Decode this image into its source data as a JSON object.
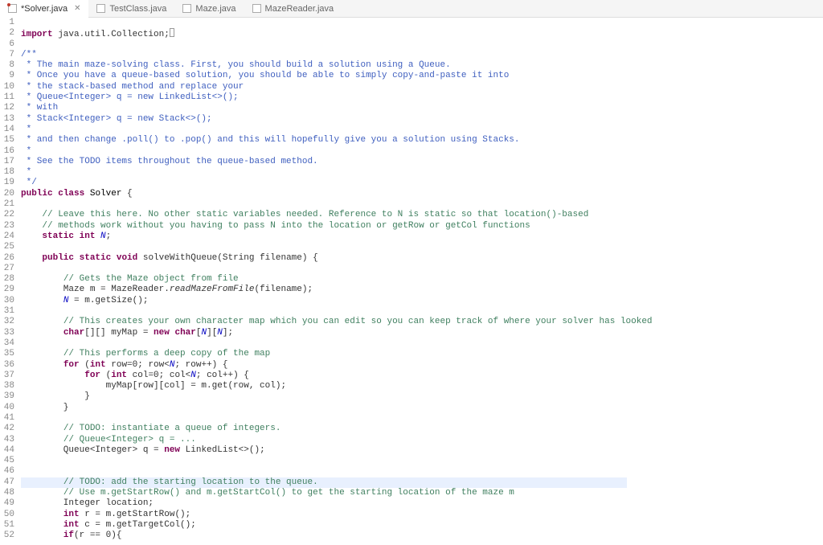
{
  "tabs": [
    {
      "label": "*Solver.java",
      "active": true,
      "dirty": true,
      "closeable": true
    },
    {
      "label": "TestClass.java",
      "active": false,
      "dirty": false,
      "closeable": false
    },
    {
      "label": "Maze.java",
      "active": false,
      "dirty": false,
      "closeable": false
    },
    {
      "label": "MazeReader.java",
      "active": false,
      "dirty": false,
      "closeable": false
    }
  ],
  "lines": [
    {
      "n": 1,
      "indent": 0,
      "tokens": []
    },
    {
      "n": 2,
      "indent": 0,
      "marker": "fold",
      "tokens": [
        [
          "kw",
          "import"
        ],
        [
          "",
          ", "
        ],
        [
          "",
          "java.util.Collection;"
        ],
        [
          "cursor",
          ""
        ]
      ],
      "join": "",
      "raw": true
    },
    {
      "n": 6,
      "indent": 0,
      "tokens": []
    },
    {
      "n": 7,
      "indent": 0,
      "marker": "fold",
      "tokens": [
        [
          "doc",
          "/**"
        ]
      ]
    },
    {
      "n": 8,
      "indent": 0,
      "tokens": [
        [
          "doc",
          " * The main maze-solving class. First, you should build a solution using a Queue."
        ]
      ]
    },
    {
      "n": 9,
      "indent": 0,
      "tokens": [
        [
          "doc",
          " * Once you have a queue-based solution, you should be able to simply copy-and-paste it into"
        ]
      ]
    },
    {
      "n": 10,
      "indent": 0,
      "tokens": [
        [
          "doc",
          " * the stack-based method and replace your"
        ]
      ]
    },
    {
      "n": 11,
      "indent": 0,
      "tokens": [
        [
          "doc",
          " * Queue<Integer> q = new LinkedList<>();"
        ]
      ]
    },
    {
      "n": 12,
      "indent": 0,
      "tokens": [
        [
          "doc",
          " * with"
        ]
      ]
    },
    {
      "n": 13,
      "indent": 0,
      "tokens": [
        [
          "doc",
          " * Stack<Integer> q = new Stack<>();"
        ]
      ]
    },
    {
      "n": 14,
      "indent": 0,
      "tokens": [
        [
          "doc",
          " *"
        ]
      ]
    },
    {
      "n": 15,
      "indent": 0,
      "tokens": [
        [
          "doc",
          " * and then change .poll() to .pop() and this will hopefully give you a solution using Stacks."
        ]
      ]
    },
    {
      "n": 16,
      "indent": 0,
      "tokens": [
        [
          "doc",
          " *"
        ]
      ]
    },
    {
      "n": 17,
      "indent": 0,
      "tokens": [
        [
          "doc",
          " * See the TODO items throughout the queue-based method."
        ]
      ]
    },
    {
      "n": 18,
      "indent": 0,
      "tokens": [
        [
          "doc",
          " *"
        ]
      ]
    },
    {
      "n": 19,
      "indent": 0,
      "tokens": [
        [
          "doc",
          " */"
        ]
      ]
    },
    {
      "n": 20,
      "indent": 0,
      "tokens": [
        [
          "kw",
          "public"
        ],
        [
          "",
          " "
        ],
        [
          "kw",
          "class"
        ],
        [
          "",
          " "
        ],
        [
          "typ",
          "Solver"
        ],
        [
          "",
          " {"
        ]
      ]
    },
    {
      "n": 21,
      "indent": 0,
      "tokens": []
    },
    {
      "n": 22,
      "indent": 1,
      "tokens": [
        [
          "cm",
          "// Leave this here. No other static variables needed. Reference to N is static so that location()-based"
        ]
      ]
    },
    {
      "n": 23,
      "indent": 1,
      "tokens": [
        [
          "cm",
          "// methods work without you having to pass N into the location or getRow or getCol functions"
        ]
      ]
    },
    {
      "n": 24,
      "indent": 1,
      "tokens": [
        [
          "kw",
          "static"
        ],
        [
          "",
          " "
        ],
        [
          "kw",
          "int"
        ],
        [
          "",
          " "
        ],
        [
          "sfld",
          "N"
        ],
        [
          "",
          ";"
        ]
      ]
    },
    {
      "n": 25,
      "indent": 0,
      "tokens": []
    },
    {
      "n": 26,
      "indent": 1,
      "marker": "fold",
      "tokens": [
        [
          "kw",
          "public"
        ],
        [
          "",
          " "
        ],
        [
          "kw",
          "static"
        ],
        [
          "",
          " "
        ],
        [
          "kw",
          "void"
        ],
        [
          "",
          " "
        ],
        [
          "",
          "solveWithQueue(String "
        ],
        [
          "",
          "filename"
        ],
        [
          "",
          ") {"
        ]
      ]
    },
    {
      "n": 27,
      "indent": 0,
      "tokens": []
    },
    {
      "n": 28,
      "indent": 2,
      "tokens": [
        [
          "cm",
          "// Gets the Maze object from file"
        ]
      ]
    },
    {
      "n": 29,
      "indent": 2,
      "tokens": [
        [
          "",
          "Maze "
        ],
        [
          "",
          "m"
        ],
        [
          "",
          " = MazeReader."
        ],
        [
          "mth",
          "readMazeFromFile"
        ],
        [
          "",
          "("
        ],
        [
          "",
          "filename"
        ],
        [
          "",
          ");"
        ]
      ]
    },
    {
      "n": 30,
      "indent": 2,
      "tokens": [
        [
          "sfld",
          "N"
        ],
        [
          "",
          " = "
        ],
        [
          "",
          "m"
        ],
        [
          "",
          ".getSize();"
        ]
      ]
    },
    {
      "n": 31,
      "indent": 0,
      "tokens": []
    },
    {
      "n": 32,
      "indent": 2,
      "tokens": [
        [
          "cm",
          "// This creates your own character map which you can edit so you can keep track of where your solver has looked"
        ]
      ]
    },
    {
      "n": 33,
      "indent": 2,
      "tokens": [
        [
          "kw",
          "char"
        ],
        [
          "",
          "[][] "
        ],
        [
          "",
          "myMap"
        ],
        [
          "",
          " = "
        ],
        [
          "kw",
          "new"
        ],
        [
          "",
          " "
        ],
        [
          "kw",
          "char"
        ],
        [
          "",
          "["
        ],
        [
          "sfld",
          "N"
        ],
        [
          "",
          "]["
        ],
        [
          "sfld",
          "N"
        ],
        [
          "",
          "];"
        ]
      ]
    },
    {
      "n": 34,
      "indent": 0,
      "tokens": []
    },
    {
      "n": 35,
      "indent": 2,
      "tokens": [
        [
          "cm",
          "// This performs a deep copy of the map"
        ]
      ]
    },
    {
      "n": 36,
      "indent": 2,
      "tokens": [
        [
          "kw",
          "for"
        ],
        [
          "",
          " ("
        ],
        [
          "kw",
          "int"
        ],
        [
          "",
          " "
        ],
        [
          "",
          "row"
        ],
        [
          "",
          "=0; "
        ],
        [
          "",
          "row"
        ],
        [
          "",
          "<"
        ],
        [
          "sfld",
          "N"
        ],
        [
          "",
          "; "
        ],
        [
          "",
          "row"
        ],
        [
          "",
          "++) {"
        ]
      ]
    },
    {
      "n": 37,
      "indent": 3,
      "tokens": [
        [
          "kw",
          "for"
        ],
        [
          "",
          " ("
        ],
        [
          "kw",
          "int"
        ],
        [
          "",
          " "
        ],
        [
          "",
          "col"
        ],
        [
          "",
          "=0; "
        ],
        [
          "",
          "col"
        ],
        [
          "",
          "<"
        ],
        [
          "sfld",
          "N"
        ],
        [
          "",
          "; "
        ],
        [
          "",
          "col"
        ],
        [
          "",
          "++) {"
        ]
      ]
    },
    {
      "n": 38,
      "indent": 4,
      "tokens": [
        [
          "",
          "myMap"
        ],
        [
          "",
          "["
        ],
        [
          "",
          "row"
        ],
        [
          "",
          "]["
        ],
        [
          "",
          "col"
        ],
        [
          "",
          "] = "
        ],
        [
          "",
          "m"
        ],
        [
          "",
          ".get("
        ],
        [
          "",
          "row"
        ],
        [
          "",
          ", "
        ],
        [
          "",
          "col"
        ],
        [
          "",
          ");"
        ]
      ]
    },
    {
      "n": 39,
      "indent": 3,
      "tokens": [
        [
          "",
          "}"
        ]
      ]
    },
    {
      "n": 40,
      "indent": 2,
      "tokens": [
        [
          "",
          "}"
        ]
      ]
    },
    {
      "n": 41,
      "indent": 0,
      "tokens": []
    },
    {
      "n": 42,
      "indent": 2,
      "tokens": [
        [
          "cm",
          "// TODO: instantiate a queue of integers."
        ]
      ]
    },
    {
      "n": 43,
      "indent": 2,
      "tokens": [
        [
          "cm",
          "// Queue<Integer> q = ..."
        ]
      ]
    },
    {
      "n": 44,
      "indent": 2,
      "tokens": [
        [
          "",
          "Queue<Integer> "
        ],
        [
          "",
          "q"
        ],
        [
          "",
          " = "
        ],
        [
          "kw",
          "new"
        ],
        [
          "",
          " LinkedList<>();"
        ]
      ]
    },
    {
      "n": 45,
      "indent": 0,
      "tokens": []
    },
    {
      "n": 46,
      "indent": 0,
      "tokens": []
    },
    {
      "n": 47,
      "indent": 2,
      "hl": true,
      "tokens": [
        [
          "cm",
          "// TODO: add the starting location to the queue."
        ]
      ]
    },
    {
      "n": 48,
      "indent": 2,
      "tokens": [
        [
          "cm",
          "// Use m.getStartRow() and m.getStartCol() to get the starting location of the maze m"
        ]
      ]
    },
    {
      "n": 49,
      "indent": 2,
      "tokens": [
        [
          "",
          "Integer "
        ],
        [
          "",
          "location"
        ],
        [
          "",
          ";"
        ]
      ]
    },
    {
      "n": 50,
      "indent": 2,
      "tokens": [
        [
          "kw",
          "int"
        ],
        [
          "",
          " "
        ],
        [
          "",
          "r"
        ],
        [
          "",
          " = "
        ],
        [
          "",
          "m"
        ],
        [
          "",
          ".getStartRow();"
        ]
      ]
    },
    {
      "n": 51,
      "indent": 2,
      "tokens": [
        [
          "kw",
          "int"
        ],
        [
          "",
          " "
        ],
        [
          "",
          "c"
        ],
        [
          "",
          " = "
        ],
        [
          "",
          "m"
        ],
        [
          "",
          ".getTargetCol();"
        ]
      ]
    },
    {
      "n": 52,
      "indent": 2,
      "tokens": [
        [
          "kw",
          "if"
        ],
        [
          "",
          "("
        ],
        [
          "",
          "r"
        ],
        [
          "",
          " == 0){"
        ]
      ]
    }
  ]
}
